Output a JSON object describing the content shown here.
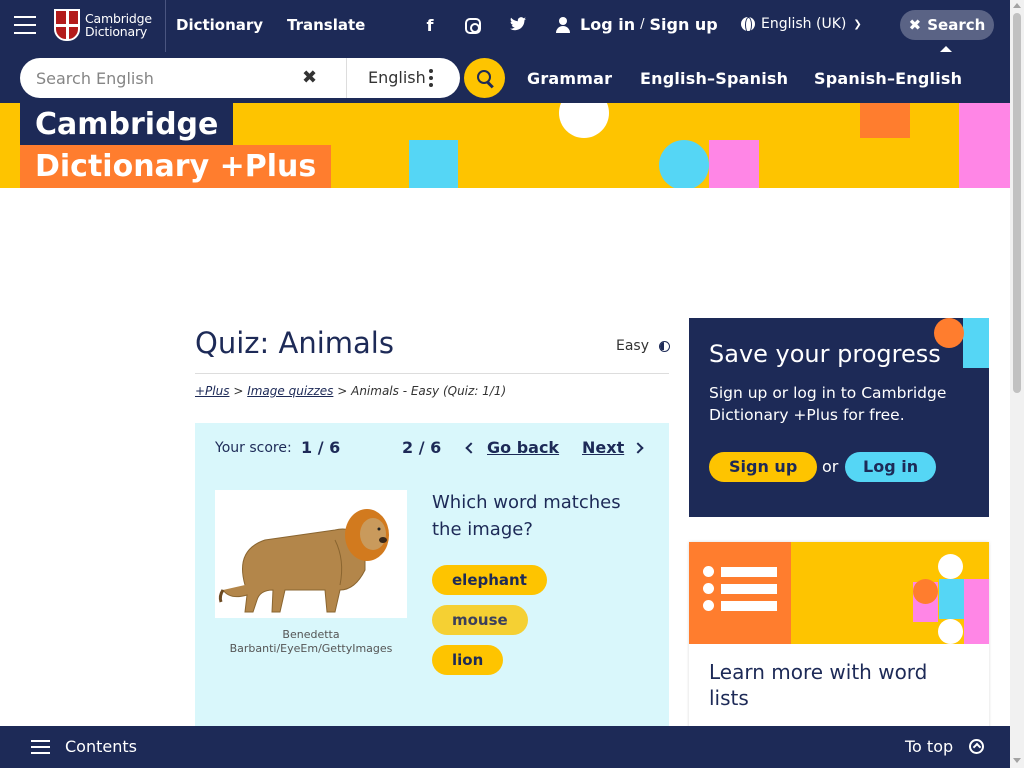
{
  "header": {
    "logo_line1": "Cambridge",
    "logo_line2": "Dictionary",
    "nav": [
      "Dictionary",
      "Translate"
    ],
    "social_icons": [
      "facebook-icon",
      "instagram-icon",
      "twitter-icon"
    ],
    "login_label": "Log in",
    "login_slash": "/",
    "signup_label": "Sign up",
    "language": "English (UK)",
    "search_toggle_label": "Search"
  },
  "searchbar": {
    "placeholder": "Search English",
    "dictionary": "English",
    "links": [
      "Grammar",
      "English–Spanish",
      "Spanish–English"
    ]
  },
  "banner": {
    "line1": "Cambridge",
    "line2": "Dictionary +Plus"
  },
  "quiz": {
    "title": "Quiz: Animals",
    "level": "Easy",
    "breadcrumb": {
      "plus": "+Plus",
      "sep1": ">",
      "image_quizzes": "Image quizzes",
      "sep2": ">",
      "current": "Animals - Easy (Quiz: 1/1)"
    },
    "score_label": "Your score:",
    "score": "1 / 6",
    "question_number": "2 / 6",
    "go_back": "Go back",
    "next": "Next",
    "image_credit": "Benedetta Barbanti/EyeEm/GettyImages",
    "question": "Which word matches the image?",
    "answers": [
      "elephant",
      "mouse",
      "lion"
    ]
  },
  "sidebar": {
    "progress_title": "Save your progress",
    "progress_text": "Sign up or log in to Cambridge Dictionary +Plus for free.",
    "signup_button": "Sign up",
    "or": "or",
    "login_button": "Log in",
    "wordlists_title": "Learn more with word lists"
  },
  "footer": {
    "contents": "Contents",
    "to_top": "To top"
  },
  "colors": {
    "navy": "#1d2a57",
    "yellow": "#fec400",
    "orange": "#ff7d2e",
    "cyan": "#55d6f5",
    "pink": "#ff86e6",
    "quiz_bg": "#d9f7fb"
  }
}
